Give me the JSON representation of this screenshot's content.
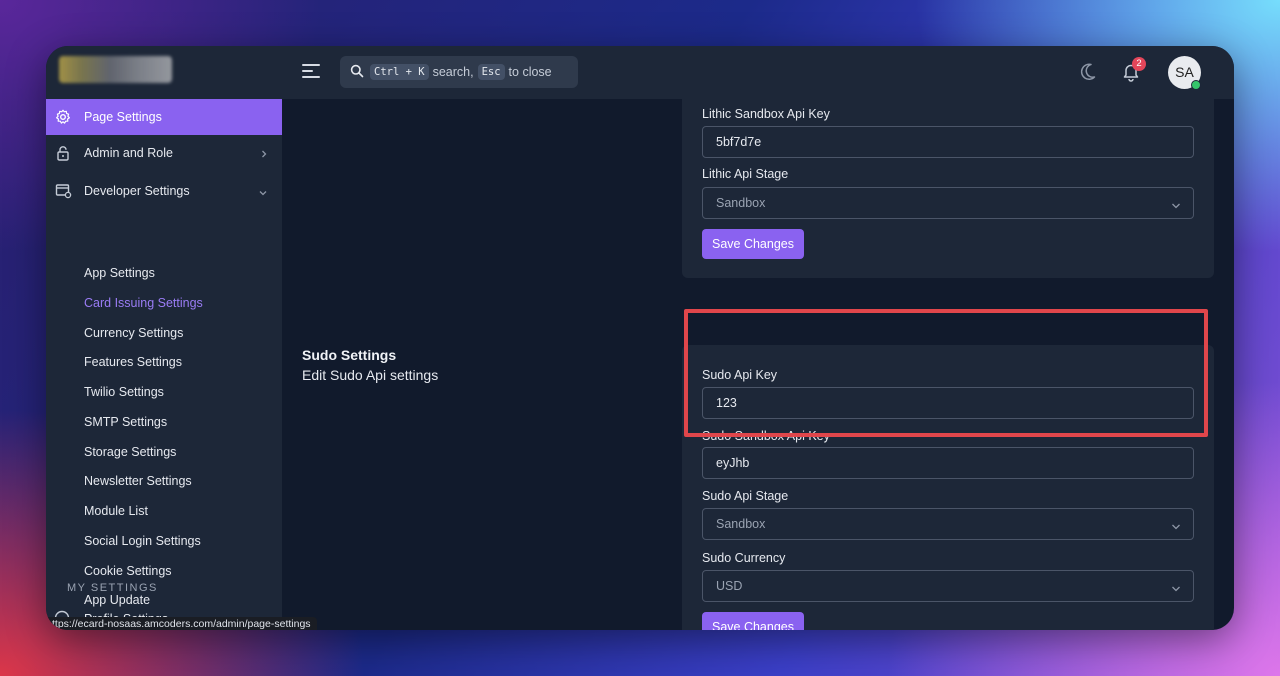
{
  "search": {
    "shortcut_1": "Ctrl + K",
    "text_1": "search,",
    "shortcut_2": "Esc",
    "text_2": "to close"
  },
  "header": {
    "notification_count": "2",
    "avatar_initials": "SA"
  },
  "sidebar": {
    "items": [
      {
        "label": "Page Settings",
        "icon": "gear-icon",
        "active": true
      },
      {
        "label": "Admin and Role",
        "icon": "lock-icon"
      },
      {
        "label": "Developer Settings",
        "icon": "developer-settings-icon"
      }
    ],
    "sub_items": [
      {
        "label": "App Settings"
      },
      {
        "label": "Card Issuing Settings",
        "active": true
      },
      {
        "label": "Currency Settings"
      },
      {
        "label": "Features Settings"
      },
      {
        "label": "Twilio Settings"
      },
      {
        "label": "SMTP Settings"
      },
      {
        "label": "Storage Settings"
      },
      {
        "label": "Newsletter Settings"
      },
      {
        "label": "Module List"
      },
      {
        "label": "Social Login Settings"
      },
      {
        "label": "Cookie Settings"
      },
      {
        "label": "App Update"
      }
    ],
    "section_label": "MY SETTINGS",
    "profile_item": "Profile Settings"
  },
  "status_url": "ttps://ecard-nosaas.amcoders.com/admin/page-settings",
  "lithic_card": {
    "sandbox_key_label": "Lithic Sandbox Api Key",
    "sandbox_key_value": "5bf7d7e",
    "stage_label": "Lithic Api Stage",
    "stage_value": "Sandbox",
    "save_label": "Save Changes"
  },
  "sudo_section": {
    "title": "Sudo Settings",
    "description": "Edit Sudo Api settings"
  },
  "sudo_card": {
    "api_key_label": "Sudo Api Key",
    "api_key_value": "123",
    "sandbox_key_label": "Sudo Sandbox Api Key",
    "sandbox_key_value": "eyJhb",
    "stage_label": "Sudo Api Stage",
    "stage_value": "Sandbox",
    "currency_label": "Sudo Currency",
    "currency_value": "USD",
    "save_label": "Save Changes"
  },
  "colors": {
    "accent": "#8a62f0",
    "highlight": "#e0464b",
    "panel": "#1d2738",
    "background": "#111a2c"
  }
}
